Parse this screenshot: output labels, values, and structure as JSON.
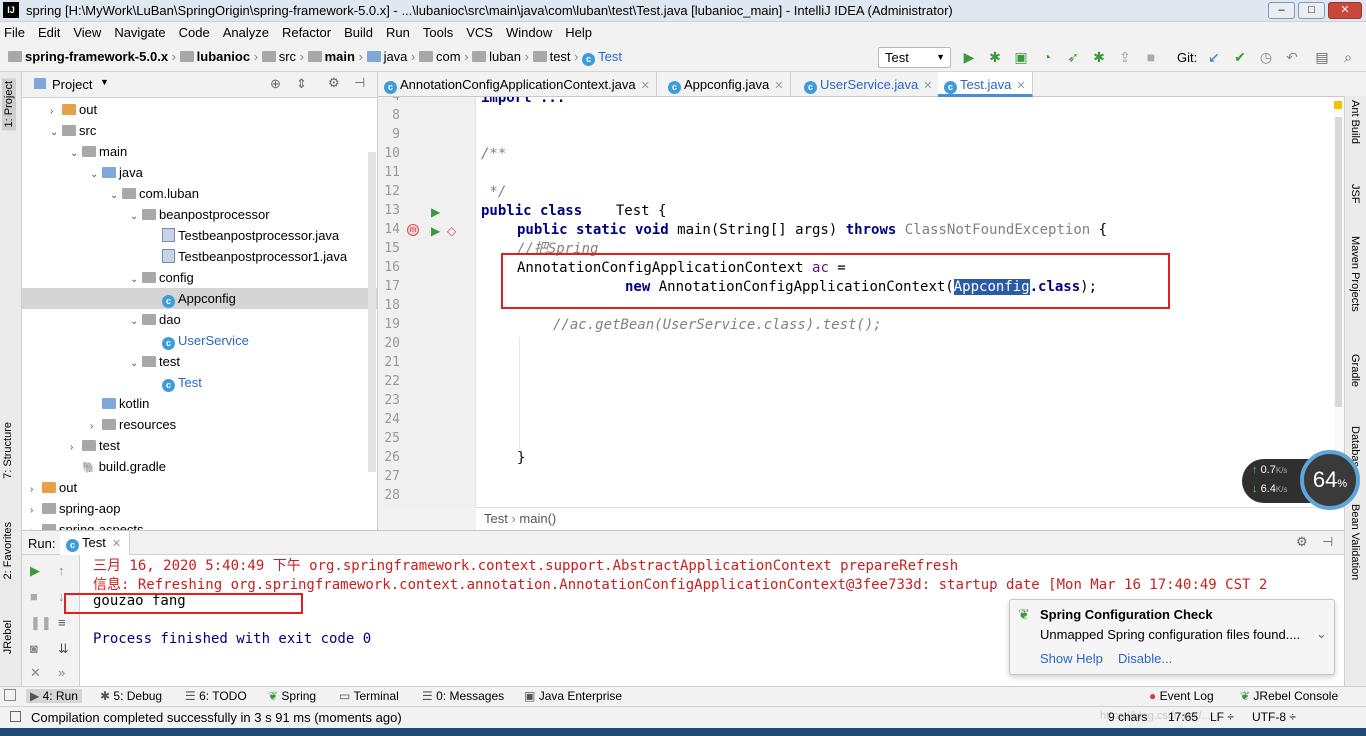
{
  "window": {
    "title": "spring [H:\\MyWork\\LuBan\\SpringOrigin\\spring-framework-5.0.x] - ...\\lubanioc\\src\\main\\java\\com\\luban\\test\\Test.java [lubanioc_main] - IntelliJ IDEA (Administrator)",
    "logo": "IJ",
    "min": "–",
    "max": "□",
    "close": "✕"
  },
  "menu": [
    "File",
    "Edit",
    "View",
    "Navigate",
    "Code",
    "Analyze",
    "Refactor",
    "Build",
    "Run",
    "Tools",
    "VCS",
    "Window",
    "Help"
  ],
  "nav": {
    "crumbs": [
      "spring-framework-5.0.x",
      "lubanioc",
      "src",
      "main",
      "java",
      "com",
      "luban",
      "test",
      "Test"
    ],
    "run_config": "Test",
    "git_label": "Git:"
  },
  "left_stripe": {
    "project": "1: Project",
    "structure": "7: Structure",
    "favorites": "2: Favorites",
    "jrebel": "JRebel"
  },
  "right_stripe": {
    "ant": "Ant Build",
    "jsf": "JSF",
    "maven": "Maven Projects",
    "gradle": "Gradle",
    "database": "Database",
    "bean": "Bean Validation"
  },
  "project": {
    "title": "Project",
    "tree": [
      {
        "label": "out",
        "depth": 2,
        "arrow": "›",
        "icon": "folder-orange"
      },
      {
        "label": "src",
        "depth": 2,
        "arrow": "⌄",
        "icon": "folder-gray"
      },
      {
        "label": "main",
        "depth": 3,
        "arrow": "⌄",
        "icon": "folder-gray"
      },
      {
        "label": "java",
        "depth": 4,
        "arrow": "⌄",
        "icon": "folder-blue"
      },
      {
        "label": "com.luban",
        "depth": 5,
        "arrow": "⌄",
        "icon": "folder-gray"
      },
      {
        "label": "beanpostprocessor",
        "depth": 6,
        "arrow": "⌄",
        "icon": "folder-gray"
      },
      {
        "label": "Testbeanpostprocessor.java",
        "depth": 7,
        "arrow": "",
        "icon": "java-file"
      },
      {
        "label": "Testbeanpostprocessor1.java",
        "depth": 7,
        "arrow": "",
        "icon": "java-file"
      },
      {
        "label": "config",
        "depth": 6,
        "arrow": "⌄",
        "icon": "folder-gray"
      },
      {
        "label": "Appconfig",
        "depth": 7,
        "arrow": "",
        "icon": "class",
        "selected": true
      },
      {
        "label": "dao",
        "depth": 6,
        "arrow": "⌄",
        "icon": "folder-gray"
      },
      {
        "label": "UserService",
        "depth": 7,
        "arrow": "",
        "icon": "class",
        "blue": true
      },
      {
        "label": "test",
        "depth": 6,
        "arrow": "⌄",
        "icon": "folder-gray"
      },
      {
        "label": "Test",
        "depth": 7,
        "arrow": "",
        "icon": "class",
        "blue": true
      },
      {
        "label": "kotlin",
        "depth": 4,
        "arrow": "",
        "icon": "folder-blue"
      },
      {
        "label": "resources",
        "depth": 4,
        "arrow": "›",
        "icon": "folder-gray"
      },
      {
        "label": "test",
        "depth": 3,
        "arrow": "›",
        "icon": "folder-gray"
      },
      {
        "label": "build.gradle",
        "depth": 3,
        "arrow": "",
        "icon": "gradle"
      },
      {
        "label": "out",
        "depth": 1,
        "arrow": "›",
        "icon": "folder-orange"
      },
      {
        "label": "spring-aop",
        "depth": 1,
        "arrow": "›",
        "icon": "folder-gray"
      },
      {
        "label": "spring-aspects",
        "depth": 1,
        "arrow": "›",
        "icon": "folder-gray"
      }
    ]
  },
  "editor": {
    "tabs": [
      "AnnotationConfigApplicationContext.java",
      "Appconfig.java",
      "UserService.java",
      "Test.java"
    ],
    "line_numbers": [
      "4",
      "8",
      "9",
      "10",
      "11",
      "12",
      "13",
      "14",
      "15",
      "16",
      "17",
      "18",
      "19",
      "20",
      "21",
      "22",
      "23",
      "24",
      "25",
      "26",
      "27",
      "28"
    ],
    "code": {
      "import": "import ...",
      "doc_open": "/**",
      "doc_close": " */",
      "class_kw": "public class",
      "class_name": "    Test {",
      "main_kw1": "public static void",
      "main_sig": " main(String[] args) ",
      "throws_kw": "throws",
      "exception": " ClassNotFoundException",
      "brace": " {",
      "comment_spring": "//把Spring",
      "ctx_type": "AnnotationConfigApplicationContext ",
      "ctx_var": "ac",
      "ctx_eq": " =",
      "new_kw": "new",
      "ctor": " AnnotationConfigApplicationContext(",
      "arg_sel": "Appconfig",
      "dot_class": ".class",
      "end": ");",
      "comment_get": "//ac.getBean(UserService.class).test();",
      "close": "}"
    },
    "breadcrumb": [
      "Test",
      "main()"
    ]
  },
  "run": {
    "label": "Run:",
    "tab": "Test",
    "lines": [
      "三月 16, 2020 5:40:49 下午 org.springframework.context.support.AbstractApplicationContext prepareRefresh",
      "信息: Refreshing org.springframework.context.annotation.AnnotationConfigApplicationContext@3fee733d: startup date [Mon Mar 16 17:40:49 CST 2",
      "gouzao fang",
      "",
      "Process finished with exit code 0"
    ]
  },
  "balloon": {
    "title": "Spring Configuration Check",
    "text": "Unmapped Spring configuration files found....",
    "link1": "Show Help",
    "link2": "Disable..."
  },
  "net": {
    "up": "0.7",
    "down": "6.4",
    "unit": "K/s",
    "percent": "64",
    "percent_sign": "%"
  },
  "tool_windows": [
    "4: Run",
    "5: Debug",
    "6: TODO",
    "Spring",
    "Terminal",
    "0: Messages",
    "Java Enterprise",
    "Event Log",
    "JRebel Console"
  ],
  "status": {
    "message": "Compilation completed successfully in 3 s 91 ms (moments ago)",
    "chars": "9 chars",
    "position": "17:65",
    "line_sep": "LF ÷",
    "encoding": "UTF-8 ÷",
    "watermark": "https://blog.csdn.net/..."
  },
  "colors": {
    "keyword": "#000080",
    "comment": "#808080",
    "selection": "#2a5aa8",
    "red_box": "#e02020",
    "error_text": "#c81e1e"
  }
}
